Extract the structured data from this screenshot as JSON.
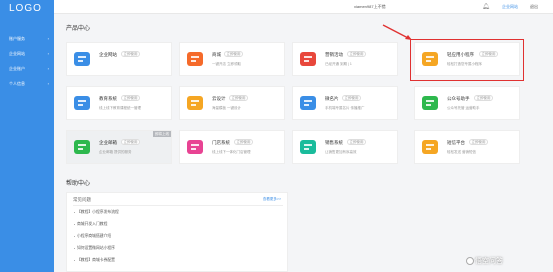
{
  "sidebar": {
    "logo": "LOGO",
    "items": [
      {
        "label": "账户服务"
      },
      {
        "label": "企业网站"
      },
      {
        "label": "企业账户"
      },
      {
        "label": "个人信息"
      }
    ]
  },
  "topbar": {
    "user": "xiamen987上不错",
    "link": "企业网站",
    "logout": "退出"
  },
  "sections": {
    "products": "产品中心",
    "help": "帮助中心"
  },
  "products": [
    {
      "name": "企业网站",
      "tag": "立即使用",
      "desc": "",
      "color": "#3a8ee6"
    },
    {
      "name": "商城",
      "tag": "立即使用",
      "desc": "一键开店 立即领取",
      "color": "#f56a2a"
    },
    {
      "name": "营销活动",
      "tag": "立即使用",
      "desc": "已经开通  到期 | 1",
      "color": "#e8473b"
    },
    {
      "name": "轻应用小程序",
      "tag": "立即使用",
      "desc": "轻松打造您专属小程序",
      "color": "#f5a623"
    },
    {
      "name": "教育系统",
      "tag": "立即使用",
      "desc": "线上线下教育课程统一管理",
      "color": "#3a8ee6"
    },
    {
      "name": "云设计",
      "tag": "立即使用",
      "desc": "海量模板 一键设计",
      "color": "#f5a623"
    },
    {
      "name": "微名片",
      "tag": "立即使用",
      "desc": "手机端专属名片 传播推广",
      "color": "#3a8ee6"
    },
    {
      "name": "公众号助手",
      "tag": "立即使用",
      "desc": "公众号托管 运营助手",
      "color": "#2db84d"
    },
    {
      "name": "企业邮箱",
      "tag": "立即使用",
      "desc": "企业邮箱 提供的服务",
      "color": "#2db84d",
      "corner": "即将上线"
    },
    {
      "name": "门店系统",
      "tag": "立即使用",
      "desc": "线上线下一体化门店管理",
      "color": "#e84393"
    },
    {
      "name": "销售系统",
      "tag": "立即使用",
      "desc": "让销售更加有序高效",
      "color": "#1abc9c"
    },
    {
      "name": "短信平台",
      "tag": "立即使用",
      "desc": "轻松发送 营销短信",
      "color": "#f5a623"
    }
  ],
  "help": {
    "heading": "常见问题",
    "more": "查看更多>>",
    "items": [
      "【教程】小程序发布流程",
      "商城开发入门教程",
      "小程序商城搭建介绍",
      "如何设置微网站小程序",
      "【教程】商城卡券配置"
    ]
  },
  "watermark": "悟空问答"
}
